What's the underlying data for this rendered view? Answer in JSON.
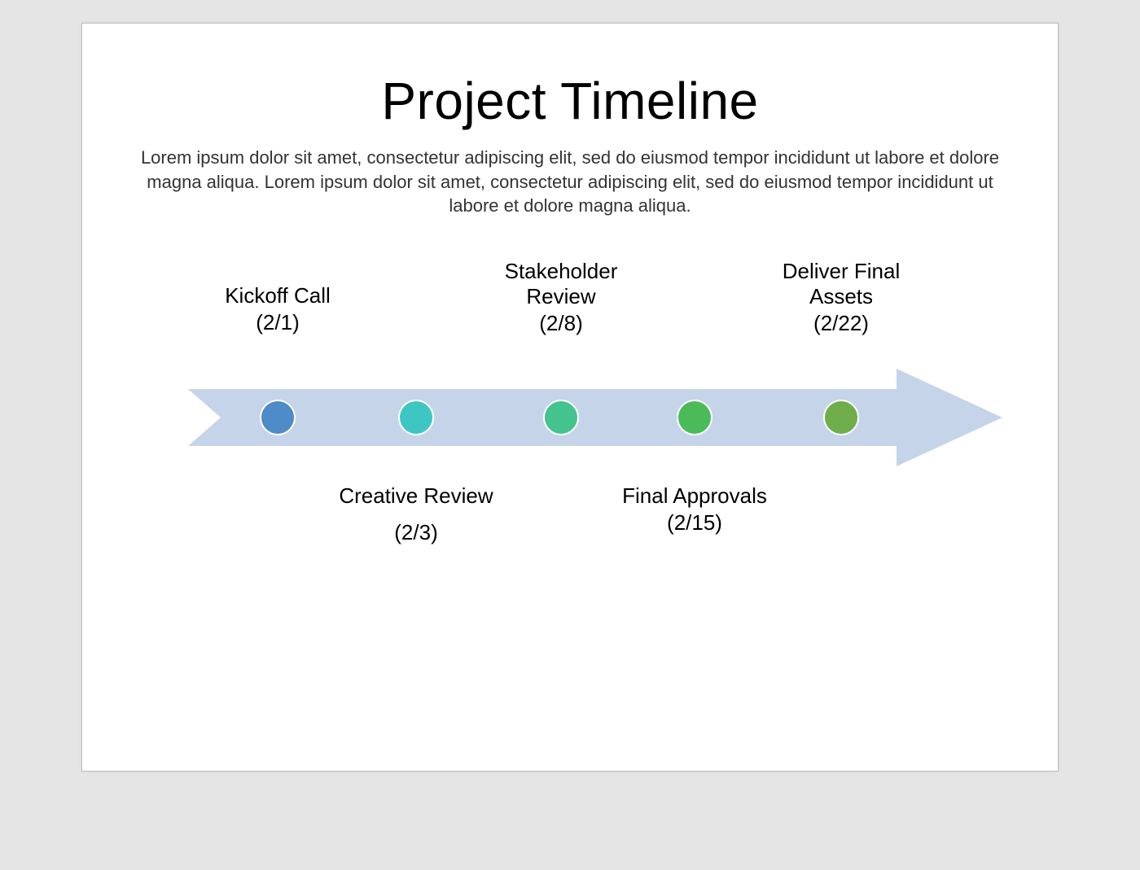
{
  "slide": {
    "title": "Project Timeline",
    "description": "Lorem ipsum dolor sit amet, consectetur adipiscing elit, sed do eiusmod tempor incididunt ut labore et dolore magna aliqua. Lorem ipsum dolor sit amet, consectetur adipiscing elit, sed do eiusmod tempor incididunt ut labore et dolore magna aliqua."
  },
  "colors": {
    "arrow_fill": "#c6d4ea",
    "dots": [
      "#4d8bc9",
      "#3ec7c2",
      "#44c38f",
      "#4bbb5a",
      "#6fae4b"
    ]
  },
  "milestones": [
    {
      "label": "Kickoff Call",
      "date": "(2/1)",
      "position": "top"
    },
    {
      "label": "Creative Review",
      "date": "(2/3)",
      "position": "bottom"
    },
    {
      "label": "Stakeholder Review",
      "date": "(2/8)",
      "position": "top"
    },
    {
      "label": "Final Approvals",
      "date": "(2/15)",
      "position": "bottom"
    },
    {
      "label": "Deliver Final Assets",
      "date": "(2/22)",
      "position": "top"
    }
  ]
}
